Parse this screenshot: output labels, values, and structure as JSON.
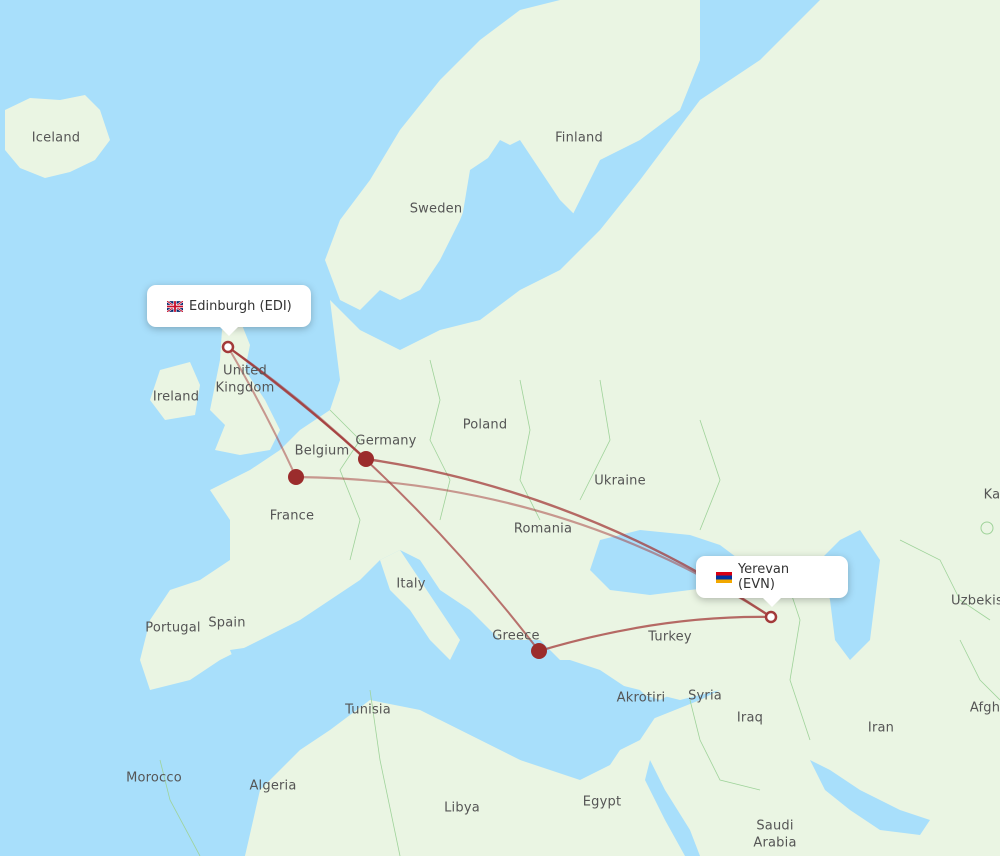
{
  "map": {
    "colors": {
      "water": "#a8dffb",
      "land": "#eaf5e3",
      "border": "#9fd39a",
      "route": "#a33a3a",
      "hub": "#9b2c2c",
      "label": "#555555"
    },
    "country_labels": [
      {
        "name": "Iceland"
      },
      {
        "name": "Finland"
      },
      {
        "name": "Sweden"
      },
      {
        "name": "United Kingdom"
      },
      {
        "name": "Ireland"
      },
      {
        "name": "Belgium"
      },
      {
        "name": "Germany"
      },
      {
        "name": "Poland"
      },
      {
        "name": "Ukraine"
      },
      {
        "name": "France"
      },
      {
        "name": "Romania"
      },
      {
        "name": "Italy"
      },
      {
        "name": "Portugal"
      },
      {
        "name": "Spain"
      },
      {
        "name": "Greece"
      },
      {
        "name": "Turkey"
      },
      {
        "name": "Akrotiri"
      },
      {
        "name": "Syria"
      },
      {
        "name": "Iraq"
      },
      {
        "name": "Iran"
      },
      {
        "name": "Tunisia"
      },
      {
        "name": "Morocco"
      },
      {
        "name": "Algeria"
      },
      {
        "name": "Libya"
      },
      {
        "name": "Egypt"
      },
      {
        "name": "Saudi Arabia"
      },
      {
        "name": "Kazakhstan (partial: Ka)"
      },
      {
        "name": "Uzbekistan (partial: Uzbekis)"
      },
      {
        "name": "Afghanistan (partial: Afgh)"
      }
    ],
    "label_text": {
      "iceland": "Iceland",
      "finland": "Finland",
      "sweden": "Sweden",
      "uk1": "United",
      "uk2": "Kingdom",
      "ireland": "Ireland",
      "belgium": "Belgium",
      "germany": "Germany",
      "poland": "Poland",
      "ukraine": "Ukraine",
      "france": "France",
      "romania": "Romania",
      "italy": "Italy",
      "portugal": "Portugal",
      "spain": "Spain",
      "greece": "Greece",
      "turkey": "Turkey",
      "akrotiri": "Akrotiri",
      "syria": "Syria",
      "iraq": "Iraq",
      "iran": "Iran",
      "tunisia": "Tunisia",
      "morocco": "Morocco",
      "algeria": "Algeria",
      "libya": "Libya",
      "egypt": "Egypt",
      "saudi1": "Saudi",
      "saudi2": "Arabia",
      "kaz": "Ka",
      "uzb": "Uzbekis",
      "afg": "Afgh"
    },
    "origin": {
      "city": "Edinburgh",
      "code": "EDI",
      "label": "Edinburgh (EDI)",
      "flag": "uk-flag"
    },
    "destination": {
      "city": "Yerevan",
      "code": "EVN",
      "label": "Yerevan (EVN)",
      "flag": "armenia-flag"
    },
    "stopovers": [
      {
        "name": "Paris area hub",
        "region": "France"
      },
      {
        "name": "Frankfurt area hub",
        "region": "Germany"
      },
      {
        "name": "Athens area hub",
        "region": "Greece"
      }
    ],
    "routes": [
      {
        "from": "EDI",
        "via": "France hub",
        "to": "EVN"
      },
      {
        "from": "EDI",
        "via": "Germany hub",
        "to": "EVN"
      },
      {
        "from": "EDI",
        "via": "Greece hub",
        "to": "EVN"
      }
    ]
  }
}
